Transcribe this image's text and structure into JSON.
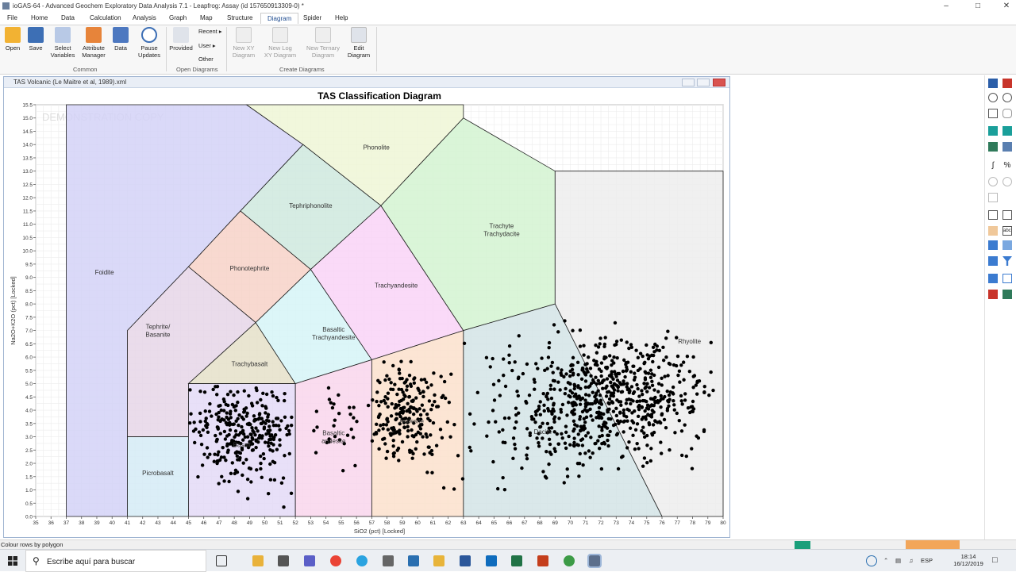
{
  "window": {
    "title": "ioGAS-64 - Advanced Geochem Exploratory Data Analysis 7.1 - Leapfrog: Assay (id 157650913309-0) *"
  },
  "menu": [
    "File",
    "Home",
    "Data",
    "Calculation",
    "Analysis",
    "Graph",
    "Map",
    "Structure",
    "Diagram",
    "Spider",
    "Help"
  ],
  "ribbon": {
    "open": "Open",
    "save": "Save",
    "select_variables_1": "Select",
    "select_variables_2": "Variables",
    "attribute_manager_1": "Attribute",
    "attribute_manager_2": "Manager",
    "data": "Data",
    "pause_updates_1": "Pause",
    "pause_updates_2": "Updates",
    "group_common": "Common",
    "provided": "Provided",
    "recent": "Recent",
    "user": "User",
    "other": "Other",
    "group_open": "Open Diagrams",
    "new_xy_1": "New XY",
    "new_xy_2": "Diagram",
    "new_log_1": "New Log",
    "new_log_2": "XY Diagram",
    "new_ternary_1": "New Ternary",
    "new_ternary_2": "Diagram",
    "edit_1": "Edit",
    "edit_2": "Diagram",
    "group_create": "Create Diagrams"
  },
  "document": {
    "title": "TAS Volcanic (Le Maitre et al, 1989).xml"
  },
  "chart_data": {
    "type": "scatter",
    "title": "TAS Classification Diagram",
    "watermark": "DEMONSTRATION COPY",
    "xlabel": "SiO2 (pct) [Locked]",
    "ylabel": "Na2O+K2O (pct) [Locked]",
    "xlim": [
      35,
      80
    ],
    "ylim": [
      0,
      15.5
    ],
    "xticks": [
      "35",
      "36",
      "37",
      "38",
      "39",
      "40",
      "41",
      "42",
      "43",
      "44",
      "45",
      "46",
      "47",
      "48",
      "49",
      "50",
      "51",
      "52",
      "53",
      "54",
      "55",
      "56",
      "57",
      "58",
      "59",
      "60",
      "61",
      "62",
      "63",
      "64",
      "65",
      "66",
      "67",
      "68",
      "69",
      "70",
      "71",
      "72",
      "73",
      "74",
      "75",
      "76",
      "77",
      "78",
      "79",
      "80"
    ],
    "yticks": [
      "0.0",
      "0.5",
      "1.0",
      "1.5",
      "2.0",
      "2.5",
      "3.0",
      "3.5",
      "4.0",
      "4.5",
      "5.0",
      "5.5",
      "6.0",
      "6.5",
      "7.0",
      "7.5",
      "8.0",
      "8.5",
      "9.0",
      "9.5",
      "10.0",
      "10.5",
      "11.0",
      "11.5",
      "12.0",
      "12.5",
      "13.0",
      "13.5",
      "14.0",
      "14.5",
      "15.0",
      "15.5"
    ],
    "fields": [
      {
        "label": "Foidite",
        "color": "#d4d2f7",
        "poly": [
          [
            37,
            0
          ],
          [
            41,
            0
          ],
          [
            41,
            7
          ],
          [
            45,
            9.4
          ],
          [
            48.4,
            11.5
          ],
          [
            52.5,
            14
          ],
          [
            48.8,
            15.5
          ],
          [
            37,
            15.5
          ]
        ],
        "lx": 39.5,
        "ly": 9.2
      },
      {
        "label": "Phonolite",
        "color": "#eef6d6",
        "poly": [
          [
            48.8,
            15.5
          ],
          [
            63,
            15.5
          ],
          [
            63,
            15
          ],
          [
            57.6,
            11.7
          ],
          [
            52.5,
            14
          ]
        ],
        "lx": 57.3,
        "ly": 13.9
      },
      {
        "label": "Tephriphonolite",
        "color": "#cfe9de",
        "poly": [
          [
            52.5,
            14
          ],
          [
            57.6,
            11.7
          ],
          [
            53,
            9.3
          ],
          [
            48.4,
            11.5
          ]
        ],
        "lx": 53,
        "ly": 11.7
      },
      {
        "label": "Phonotephrite",
        "color": "#f7d2c8",
        "poly": [
          [
            48.4,
            11.5
          ],
          [
            53,
            9.3
          ],
          [
            49.4,
            7.3
          ],
          [
            45,
            9.4
          ]
        ],
        "lx": 49,
        "ly": 9.35
      },
      {
        "label": "Tephrite/\nBasanite",
        "color": "#e6d6e7",
        "poly": [
          [
            41,
            3
          ],
          [
            41,
            7
          ],
          [
            45,
            9.4
          ],
          [
            49.4,
            7.3
          ],
          [
            45,
            5
          ],
          [
            45,
            3
          ]
        ],
        "lx": 43,
        "ly": 7
      },
      {
        "label": "Trachybasalt",
        "color": "#e5e0c9",
        "poly": [
          [
            45,
            5
          ],
          [
            49.4,
            7.3
          ],
          [
            52,
            5
          ]
        ],
        "lx": 49,
        "ly": 5.75
      },
      {
        "label": "Basaltic\nTrachyandesite",
        "color": "#d6f4f7",
        "poly": [
          [
            49.4,
            7.3
          ],
          [
            53,
            9.3
          ],
          [
            57,
            5.9
          ],
          [
            52,
            5
          ]
        ],
        "lx": 54.5,
        "ly": 6.9
      },
      {
        "label": "Trachyandesite",
        "color": "#f9d4f7",
        "poly": [
          [
            53,
            9.3
          ],
          [
            57.6,
            11.7
          ],
          [
            63,
            7
          ],
          [
            57,
            5.9
          ]
        ],
        "lx": 58.6,
        "ly": 8.7
      },
      {
        "label": "Trachyte\nTrachydacite",
        "color": "#d3f3d1",
        "poly": [
          [
            57.6,
            11.7
          ],
          [
            63,
            15
          ],
          [
            69,
            13
          ],
          [
            69,
            8
          ],
          [
            63,
            7
          ]
        ],
        "lx": 65.5,
        "ly": 10.8
      },
      {
        "label": "Rhyolite",
        "color": "#ededed",
        "poly": [
          [
            69,
            13
          ],
          [
            80,
            13
          ],
          [
            80,
            0
          ],
          [
            76,
            0
          ],
          [
            69,
            8
          ]
        ],
        "lx": 77.8,
        "ly": 6.6
      },
      {
        "label": "Picrobasalt",
        "color": "#d5ebf6",
        "poly": [
          [
            41,
            0
          ],
          [
            45,
            0
          ],
          [
            45,
            3
          ],
          [
            41,
            3
          ]
        ],
        "lx": 43,
        "ly": 1.65
      },
      {
        "label": "Basalt",
        "color": "#e4dbf7",
        "poly": [
          [
            45,
            0
          ],
          [
            52,
            0
          ],
          [
            52,
            5
          ],
          [
            45,
            5
          ]
        ],
        "lx": 48.5,
        "ly": 2.7
      },
      {
        "label": "Basaltic\nandesite",
        "color": "#f9d6ec",
        "poly": [
          [
            52,
            0
          ],
          [
            57,
            0
          ],
          [
            57,
            5.9
          ],
          [
            52,
            5
          ]
        ],
        "lx": 54.5,
        "ly": 3
      },
      {
        "label": "Andesite",
        "color": "#fbe0cc",
        "poly": [
          [
            57,
            0
          ],
          [
            63,
            0
          ],
          [
            63,
            7
          ],
          [
            57,
            5.9
          ]
        ],
        "lx": 59.6,
        "ly": 3.6
      },
      {
        "label": "Dacite",
        "color": "#d3e4e6",
        "poly": [
          [
            63,
            0
          ],
          [
            76,
            0
          ],
          [
            69,
            8
          ],
          [
            63,
            7
          ]
        ],
        "lx": 68.2,
        "ly": 3.2
      }
    ],
    "clusters": [
      {
        "x": [
          45,
          52
        ],
        "y": [
          0.3,
          4.9
        ],
        "n": 300,
        "cx": 48.6,
        "cy": 3.2,
        "sx": 1.6,
        "sy": 0.9
      },
      {
        "x": [
          52,
          57
        ],
        "y": [
          1.2,
          5.0
        ],
        "n": 30,
        "cx": 54.5,
        "cy": 3.3,
        "sx": 1.3,
        "sy": 0.8
      },
      {
        "x": [
          57,
          63
        ],
        "y": [
          0.3,
          5.9
        ],
        "n": 220,
        "cx": 59.4,
        "cy": 3.9,
        "sx": 1.2,
        "sy": 0.9
      },
      {
        "x": [
          63,
          76
        ],
        "y": [
          0.4,
          7.5
        ],
        "n": 380,
        "cx": 70.5,
        "cy": 4.1,
        "sx": 3.0,
        "sy": 1.2
      },
      {
        "x": [
          70,
          79.5
        ],
        "y": [
          1.8,
          7.2
        ],
        "n": 340,
        "cx": 74,
        "cy": 4.7,
        "sx": 2.6,
        "sy": 1.0
      }
    ],
    "grid": true
  },
  "toolbar_icons": [
    "zoom-in-icon",
    "zoom-out-icon",
    "pan-icon",
    "eye-icon",
    "legend-icon",
    "formula-icon",
    "percent-icon",
    "polygon-icon",
    "label-icon",
    "lock-icon",
    "filter-icon"
  ],
  "status": {
    "text": "Colour rows by polygon"
  },
  "taskbar": {
    "search_placeholder": "Escribe aquí para buscar",
    "lang": "ESP",
    "time": "18:14",
    "date": "16/12/2019"
  }
}
